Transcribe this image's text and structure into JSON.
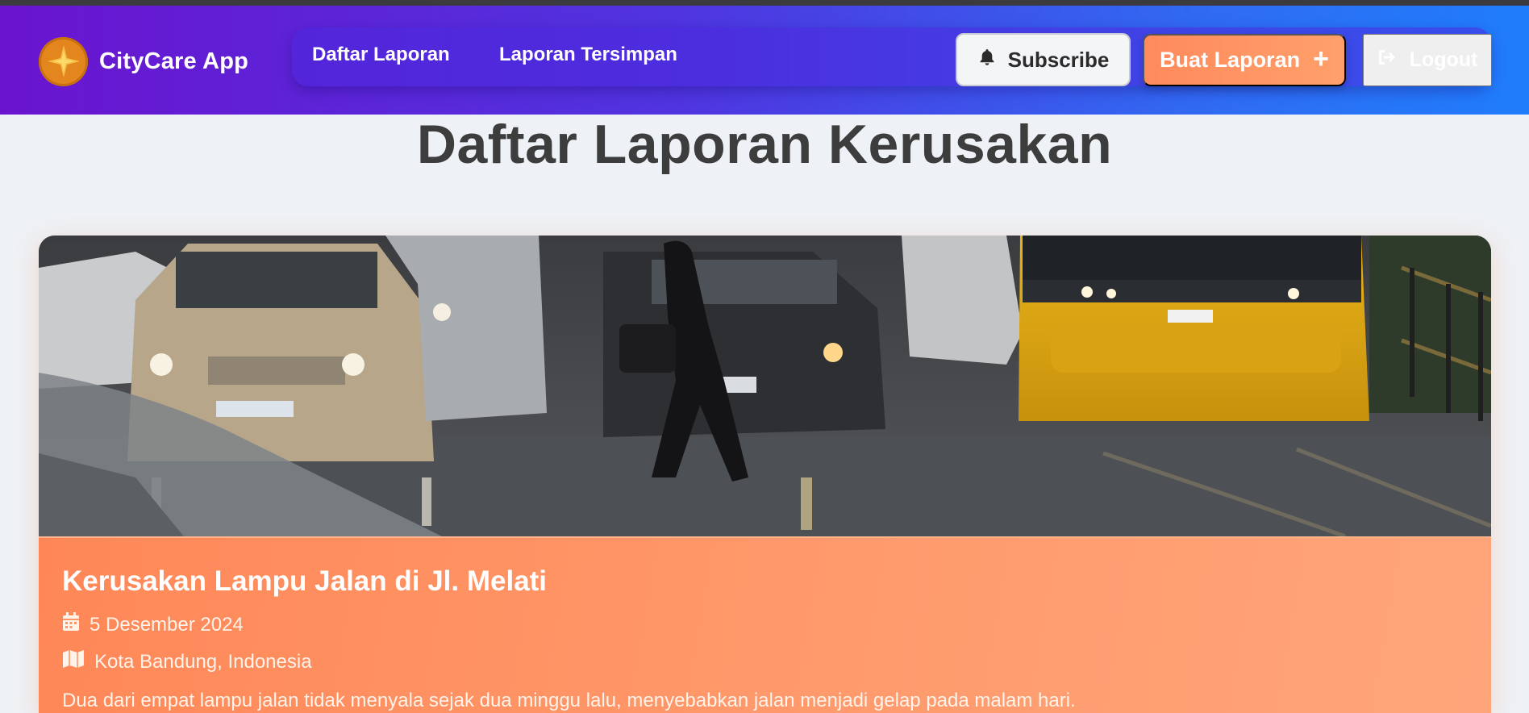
{
  "app": {
    "brand_name": "CityCare App",
    "logo_icon": "compass-star-icon"
  },
  "nav": {
    "links": [
      {
        "label": "Daftar Laporan"
      },
      {
        "label": "Laporan Tersimpan"
      }
    ],
    "subscribe_label": "Subscribe",
    "subscribe_icon": "bell-icon",
    "create_label": "Buat Laporan",
    "create_icon": "plus-icon",
    "logout_label": "Logout",
    "logout_icon": "sign-out-icon"
  },
  "page": {
    "title": "Daftar Laporan Kerusakan"
  },
  "reports": [
    {
      "title": "Kerusakan Lampu Jalan di Jl. Melati",
      "date": "5 Desember 2024",
      "date_icon": "calendar-icon",
      "location": "Kota Bandung, Indonesia",
      "location_icon": "map-icon",
      "description": "Dua dari empat lampu jalan tidak menyala sejak dua minggu lalu, menyebabkan jalan menjadi gelap pada malam hari.",
      "image_description": "street-traffic-photo"
    }
  ],
  "colors": {
    "nav_gradient_start": "#6a14cf",
    "nav_gradient_end": "#1f7dfb",
    "accent_orange": "#ff8a5c",
    "logo_orange": "#e3861d",
    "title_text": "#3d3d3d",
    "background": "#eef1f5"
  }
}
